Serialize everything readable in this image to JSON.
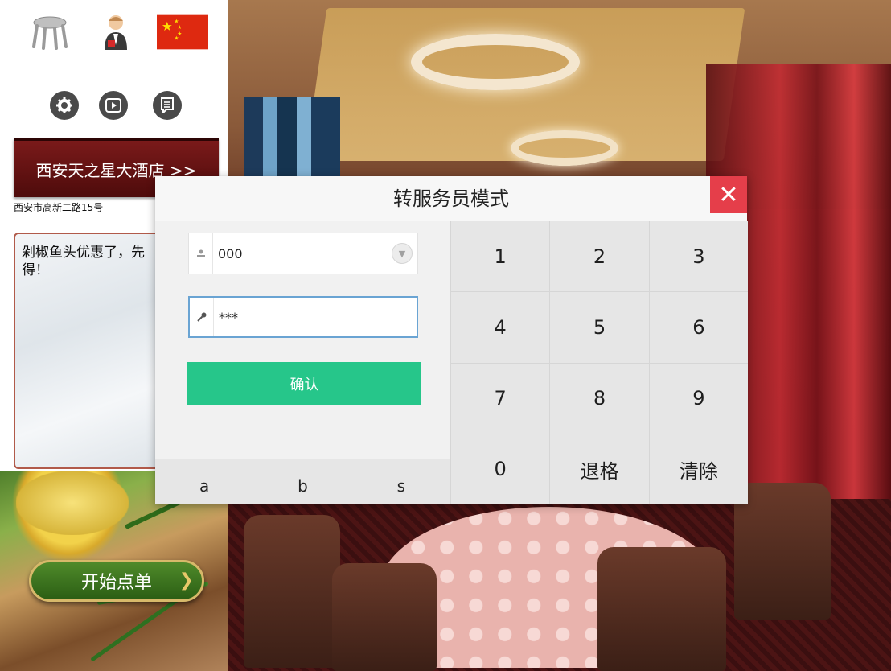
{
  "sidebar": {
    "icons": {
      "table": "table-icon",
      "waiter": "waiter-icon",
      "language": "china-flag-icon",
      "settings": "gear-icon",
      "video": "play-icon",
      "notes": "message-icon"
    },
    "hotel_name": "西安天之星大酒店 >>",
    "address": "西安市高新二路15号",
    "promo_text": "剁椒鱼头优惠了，先得！",
    "start_order_label": "开始点单"
  },
  "dialog": {
    "title": "转服务员模式",
    "close_label": "✕",
    "username_value": "000",
    "password_value": "***",
    "confirm_label": "确认",
    "keypad": [
      "1",
      "2",
      "3",
      "4",
      "5",
      "6",
      "7",
      "8",
      "9",
      "0",
      "退格",
      "清除"
    ],
    "letters": [
      "a",
      "b",
      "s"
    ]
  },
  "colors": {
    "confirm": "#26c68a",
    "close": "#e53e4a",
    "banner": "#6a1414",
    "start_order": "#3b7420"
  }
}
